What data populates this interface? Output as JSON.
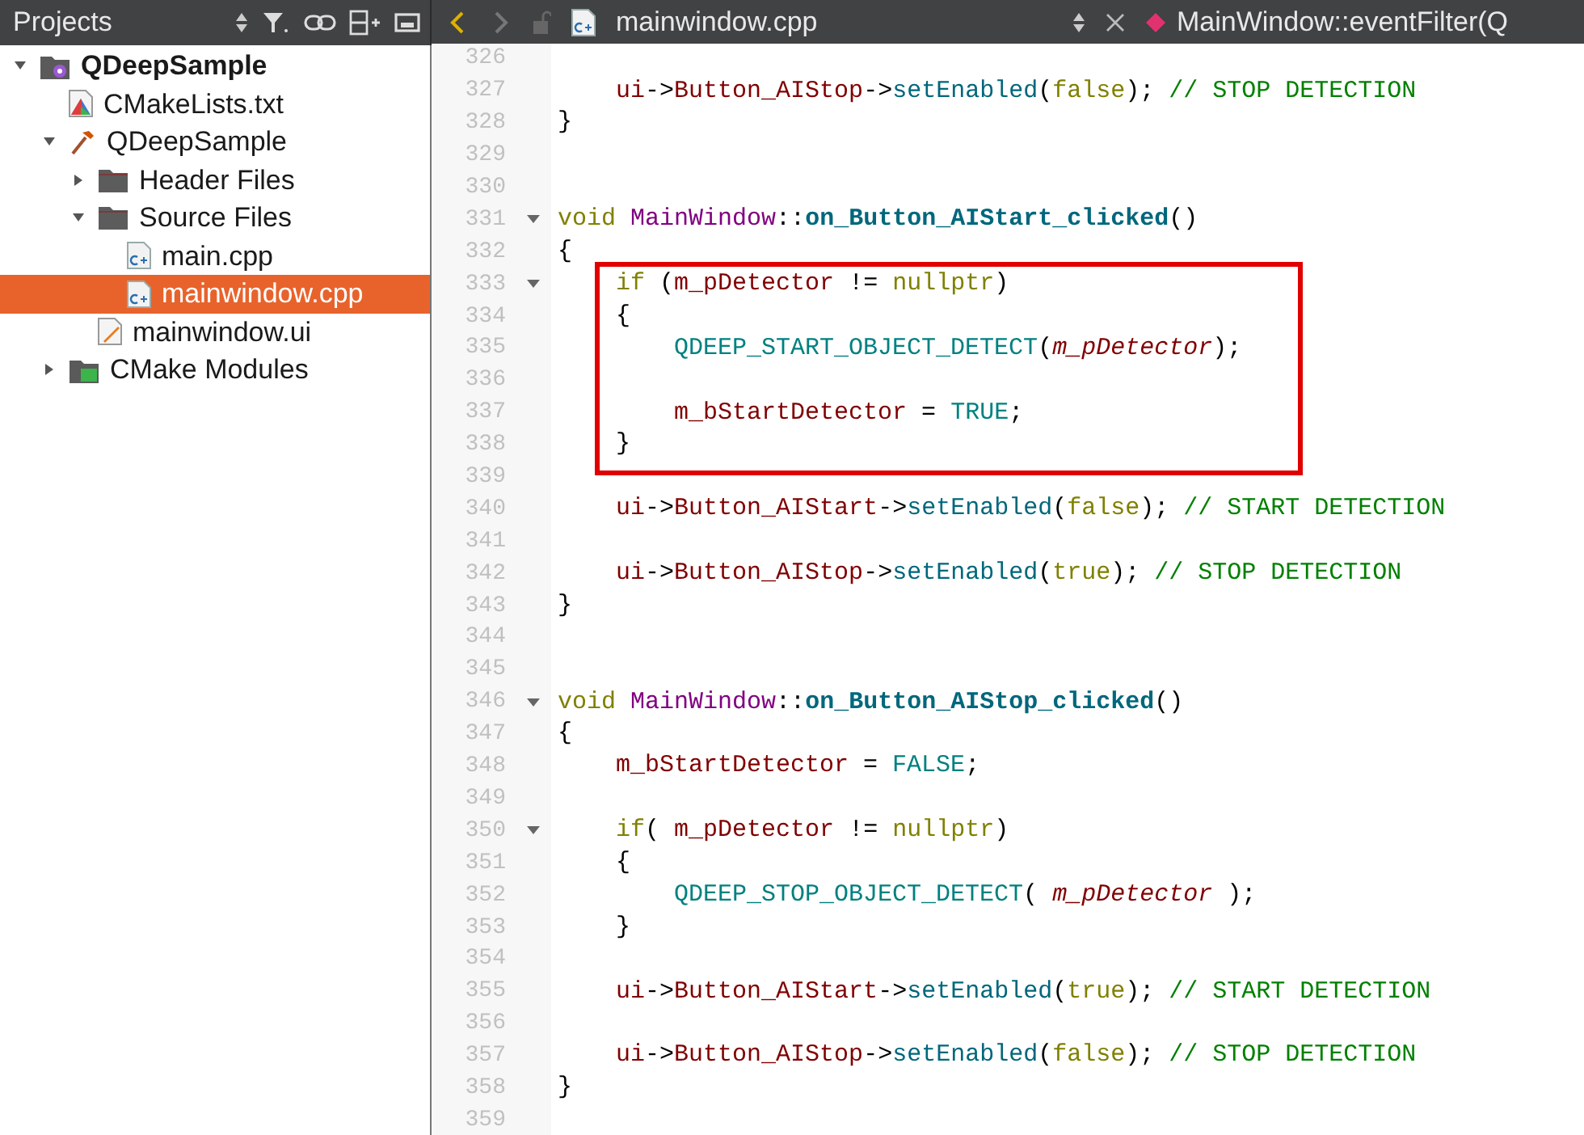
{
  "sidebar": {
    "title": "Projects",
    "tree": [
      {
        "label": "QDeepSample",
        "kind": "project",
        "bold": true,
        "expanded": true,
        "selected": false,
        "children": [
          {
            "label": "CMakeLists.txt",
            "kind": "cmake",
            "selected": false
          },
          {
            "label": "QDeepSample",
            "kind": "target",
            "expanded": true,
            "selected": false,
            "children": [
              {
                "label": "Header Files",
                "kind": "folder",
                "expanded": false,
                "selected": false
              },
              {
                "label": "Source Files",
                "kind": "folder",
                "expanded": true,
                "selected": false,
                "children": [
                  {
                    "label": "main.cpp",
                    "kind": "cpp",
                    "selected": false
                  },
                  {
                    "label": "mainwindow.cpp",
                    "kind": "cpp",
                    "selected": true
                  }
                ]
              },
              {
                "label": "mainwindow.ui",
                "kind": "ui",
                "selected": false
              }
            ]
          },
          {
            "label": "CMake Modules",
            "kind": "modules",
            "expanded": false,
            "selected": false
          }
        ]
      }
    ]
  },
  "editor_toolbar": {
    "file": "mainwindow.cpp",
    "symbol": "MainWindow::eventFilter(Q"
  },
  "code": [
    {
      "number": "326",
      "fold": false
    },
    {
      "number": "327",
      "fold": false,
      "tokens": [
        {
          "kind": "var",
          "text": "    ui"
        },
        {
          "kind": "punct",
          "text": "->"
        },
        {
          "kind": "var",
          "text": "Button_AIStop"
        },
        {
          "kind": "punct",
          "text": "->"
        },
        {
          "kind": "call",
          "text": "setEnabled"
        },
        {
          "kind": "punct",
          "text": "("
        },
        {
          "kind": "keyword",
          "text": "false"
        },
        {
          "kind": "punct",
          "text": "); "
        },
        {
          "kind": "comment",
          "text": "// STOP DETECTION"
        }
      ]
    },
    {
      "number": "328",
      "fold": false,
      "tokens": [
        {
          "kind": "punct",
          "text": "}"
        }
      ]
    },
    {
      "number": "329",
      "fold": false
    },
    {
      "number": "330",
      "fold": false
    },
    {
      "number": "331",
      "fold": true,
      "tokens": [
        {
          "kind": "keyword",
          "text": "void"
        },
        {
          "kind": "class",
          "text": " MainWindow"
        },
        {
          "kind": "punct",
          "text": "::"
        },
        {
          "kind": "func",
          "text": "on_Button_AIStart_clicked"
        },
        {
          "kind": "punct",
          "text": "()"
        }
      ]
    },
    {
      "number": "332",
      "fold": false,
      "tokens": [
        {
          "kind": "punct",
          "text": "{"
        }
      ]
    },
    {
      "number": "333",
      "fold": true,
      "tokens": [
        {
          "kind": "keyword",
          "text": "    if"
        },
        {
          "kind": "punct",
          "text": " ("
        },
        {
          "kind": "var",
          "text": "m_pDetector"
        },
        {
          "kind": "punct",
          "text": " != "
        },
        {
          "kind": "keyword",
          "text": "nullptr"
        },
        {
          "kind": "punct",
          "text": ")"
        }
      ]
    },
    {
      "number": "334",
      "fold": false,
      "tokens": [
        {
          "kind": "punct",
          "text": "    {"
        }
      ]
    },
    {
      "number": "335",
      "fold": false,
      "tokens": [
        {
          "kind": "macro",
          "text": "        QDEEP_START_OBJECT_DETECT"
        },
        {
          "kind": "punct",
          "text": "("
        },
        {
          "kind": "param",
          "text": "m_pDetector"
        },
        {
          "kind": "punct",
          "text": ");"
        }
      ]
    },
    {
      "number": "336",
      "fold": false
    },
    {
      "number": "337",
      "fold": false,
      "tokens": [
        {
          "kind": "var",
          "text": "        m_bStartDetector"
        },
        {
          "kind": "punct",
          "text": " = "
        },
        {
          "kind": "macro",
          "text": "TRUE"
        },
        {
          "kind": "punct",
          "text": ";"
        }
      ]
    },
    {
      "number": "338",
      "fold": false,
      "tokens": [
        {
          "kind": "punct",
          "text": "    }"
        }
      ]
    },
    {
      "number": "339",
      "fold": false
    },
    {
      "number": "340",
      "fold": false,
      "tokens": [
        {
          "kind": "var",
          "text": "    ui"
        },
        {
          "kind": "punct",
          "text": "->"
        },
        {
          "kind": "var",
          "text": "Button_AIStart"
        },
        {
          "kind": "punct",
          "text": "->"
        },
        {
          "kind": "call",
          "text": "setEnabled"
        },
        {
          "kind": "punct",
          "text": "("
        },
        {
          "kind": "keyword",
          "text": "false"
        },
        {
          "kind": "punct",
          "text": "); "
        },
        {
          "kind": "comment",
          "text": "// START DETECTION"
        }
      ]
    },
    {
      "number": "341",
      "fold": false
    },
    {
      "number": "342",
      "fold": false,
      "tokens": [
        {
          "kind": "var",
          "text": "    ui"
        },
        {
          "kind": "punct",
          "text": "->"
        },
        {
          "kind": "var",
          "text": "Button_AIStop"
        },
        {
          "kind": "punct",
          "text": "->"
        },
        {
          "kind": "call",
          "text": "setEnabled"
        },
        {
          "kind": "punct",
          "text": "("
        },
        {
          "kind": "keyword",
          "text": "true"
        },
        {
          "kind": "punct",
          "text": "); "
        },
        {
          "kind": "comment",
          "text": "// STOP DETECTION"
        }
      ]
    },
    {
      "number": "343",
      "fold": false,
      "tokens": [
        {
          "kind": "punct",
          "text": "}"
        }
      ]
    },
    {
      "number": "344",
      "fold": false
    },
    {
      "number": "345",
      "fold": false
    },
    {
      "number": "346",
      "fold": true,
      "tokens": [
        {
          "kind": "keyword",
          "text": "void"
        },
        {
          "kind": "class",
          "text": " MainWindow"
        },
        {
          "kind": "punct",
          "text": "::"
        },
        {
          "kind": "func",
          "text": "on_Button_AIStop_clicked"
        },
        {
          "kind": "punct",
          "text": "()"
        }
      ]
    },
    {
      "number": "347",
      "fold": false,
      "tokens": [
        {
          "kind": "punct",
          "text": "{"
        }
      ]
    },
    {
      "number": "348",
      "fold": false,
      "tokens": [
        {
          "kind": "var",
          "text": "    m_bStartDetector"
        },
        {
          "kind": "punct",
          "text": " = "
        },
        {
          "kind": "macro",
          "text": "FALSE"
        },
        {
          "kind": "punct",
          "text": ";"
        }
      ]
    },
    {
      "number": "349",
      "fold": false
    },
    {
      "number": "350",
      "fold": true,
      "tokens": [
        {
          "kind": "keyword",
          "text": "    if"
        },
        {
          "kind": "punct",
          "text": "( "
        },
        {
          "kind": "var",
          "text": "m_pDetector"
        },
        {
          "kind": "punct",
          "text": " != "
        },
        {
          "kind": "keyword",
          "text": "nullptr"
        },
        {
          "kind": "punct",
          "text": ")"
        }
      ]
    },
    {
      "number": "351",
      "fold": false,
      "tokens": [
        {
          "kind": "punct",
          "text": "    {"
        }
      ]
    },
    {
      "number": "352",
      "fold": false,
      "tokens": [
        {
          "kind": "macro",
          "text": "        QDEEP_STOP_OBJECT_DETECT"
        },
        {
          "kind": "punct",
          "text": "( "
        },
        {
          "kind": "param",
          "text": "m_pDetector"
        },
        {
          "kind": "punct",
          "text": " );"
        }
      ]
    },
    {
      "number": "353",
      "fold": false,
      "tokens": [
        {
          "kind": "punct",
          "text": "    }"
        }
      ]
    },
    {
      "number": "354",
      "fold": false
    },
    {
      "number": "355",
      "fold": false,
      "tokens": [
        {
          "kind": "var",
          "text": "    ui"
        },
        {
          "kind": "punct",
          "text": "->"
        },
        {
          "kind": "var",
          "text": "Button_AIStart"
        },
        {
          "kind": "punct",
          "text": "->"
        },
        {
          "kind": "call",
          "text": "setEnabled"
        },
        {
          "kind": "punct",
          "text": "("
        },
        {
          "kind": "keyword",
          "text": "true"
        },
        {
          "kind": "punct",
          "text": "); "
        },
        {
          "kind": "comment",
          "text": "// START DETECTION"
        }
      ]
    },
    {
      "number": "356",
      "fold": false
    },
    {
      "number": "357",
      "fold": false,
      "tokens": [
        {
          "kind": "var",
          "text": "    ui"
        },
        {
          "kind": "punct",
          "text": "->"
        },
        {
          "kind": "var",
          "text": "Button_AIStop"
        },
        {
          "kind": "punct",
          "text": "->"
        },
        {
          "kind": "call",
          "text": "setEnabled"
        },
        {
          "kind": "punct",
          "text": "("
        },
        {
          "kind": "keyword",
          "text": "false"
        },
        {
          "kind": "punct",
          "text": "); "
        },
        {
          "kind": "comment",
          "text": "// STOP DETECTION"
        }
      ]
    },
    {
      "number": "358",
      "fold": false,
      "tokens": [
        {
          "kind": "punct",
          "text": "}"
        }
      ]
    },
    {
      "number": "359",
      "fold": false
    }
  ]
}
